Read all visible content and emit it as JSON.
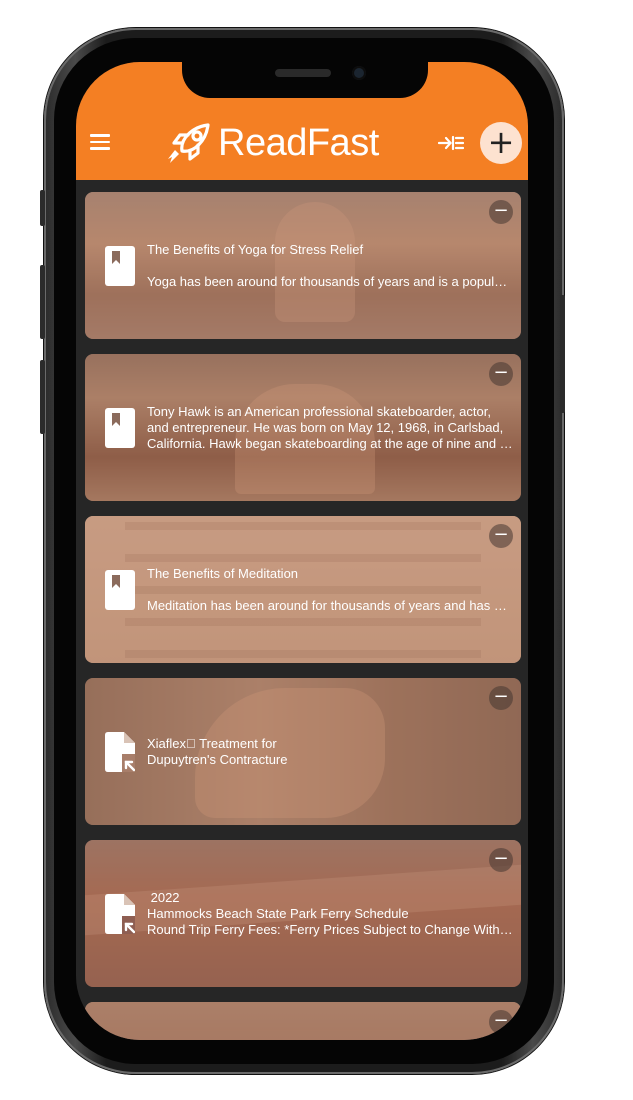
{
  "app": {
    "name": "ReadFast"
  },
  "header": {
    "menu_icon": "hamburger-menu-icon",
    "logo_icon": "rocket-icon",
    "import_icon": "import-arrow-icon",
    "add_label": "+",
    "brand_color": "#f47f23"
  },
  "documents": [
    {
      "type": "book",
      "icon": "bookmark-document-icon",
      "lines": [
        "The Benefits of Yoga for Stress Relief",
        "",
        "Yoga has been around for thousands of years and is a popular practice for stress relief."
      ],
      "remove_label": "−"
    },
    {
      "type": "book",
      "icon": "bookmark-document-icon",
      "text": "Tony Hawk is an American professional skateboarder, actor, and entrepreneur. He was born on May 12, 1968, in Carlsbad, California. Hawk began skateboarding at the age of nine and …",
      "remove_label": "−"
    },
    {
      "type": "book",
      "icon": "bookmark-document-icon",
      "lines": [
        "The Benefits of Meditation",
        "",
        "Meditation has been around for thousands of years and has been shown to help."
      ],
      "remove_label": "−"
    },
    {
      "type": "file",
      "icon": "file-import-icon",
      "lines": [
        "Xiaflex\u0000 Treatment for",
        "Dupuytren's Contracture"
      ],
      "remove_label": "−"
    },
    {
      "type": "file",
      "icon": "file-import-icon",
      "lines": [
        " 2022",
        "Hammocks Beach State Park Ferry Schedule",
        "Round Trip Ferry Fees: *Ferry Prices Subject to Change Without Notice"
      ],
      "remove_label": "−"
    },
    {
      "type": "book",
      "icon": "bookmark-document-icon",
      "lines": [],
      "remove_label": "−"
    }
  ]
}
